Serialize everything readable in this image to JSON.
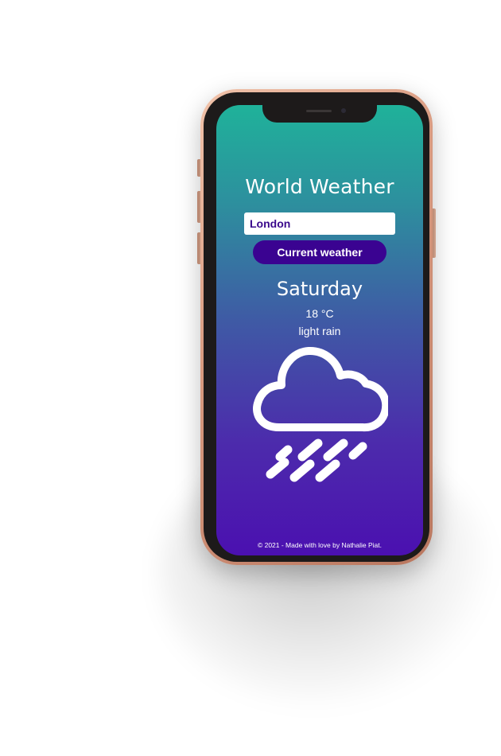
{
  "app": {
    "title": "World Weather"
  },
  "search": {
    "value": "London"
  },
  "button": {
    "label": "Current weather"
  },
  "weather": {
    "day": "Saturday",
    "temperature": "18 °C",
    "description": "light rain",
    "icon": "rain-cloud-icon"
  },
  "footer": {
    "text": "© 2021 - Made with love by Nathalie Piat."
  },
  "colors": {
    "gradient_top": "#1fb29a",
    "gradient_bottom": "#4b10b0",
    "button_bg": "#3a0391",
    "input_text": "#3a0a8c",
    "phone_frame": "#d89a80"
  }
}
